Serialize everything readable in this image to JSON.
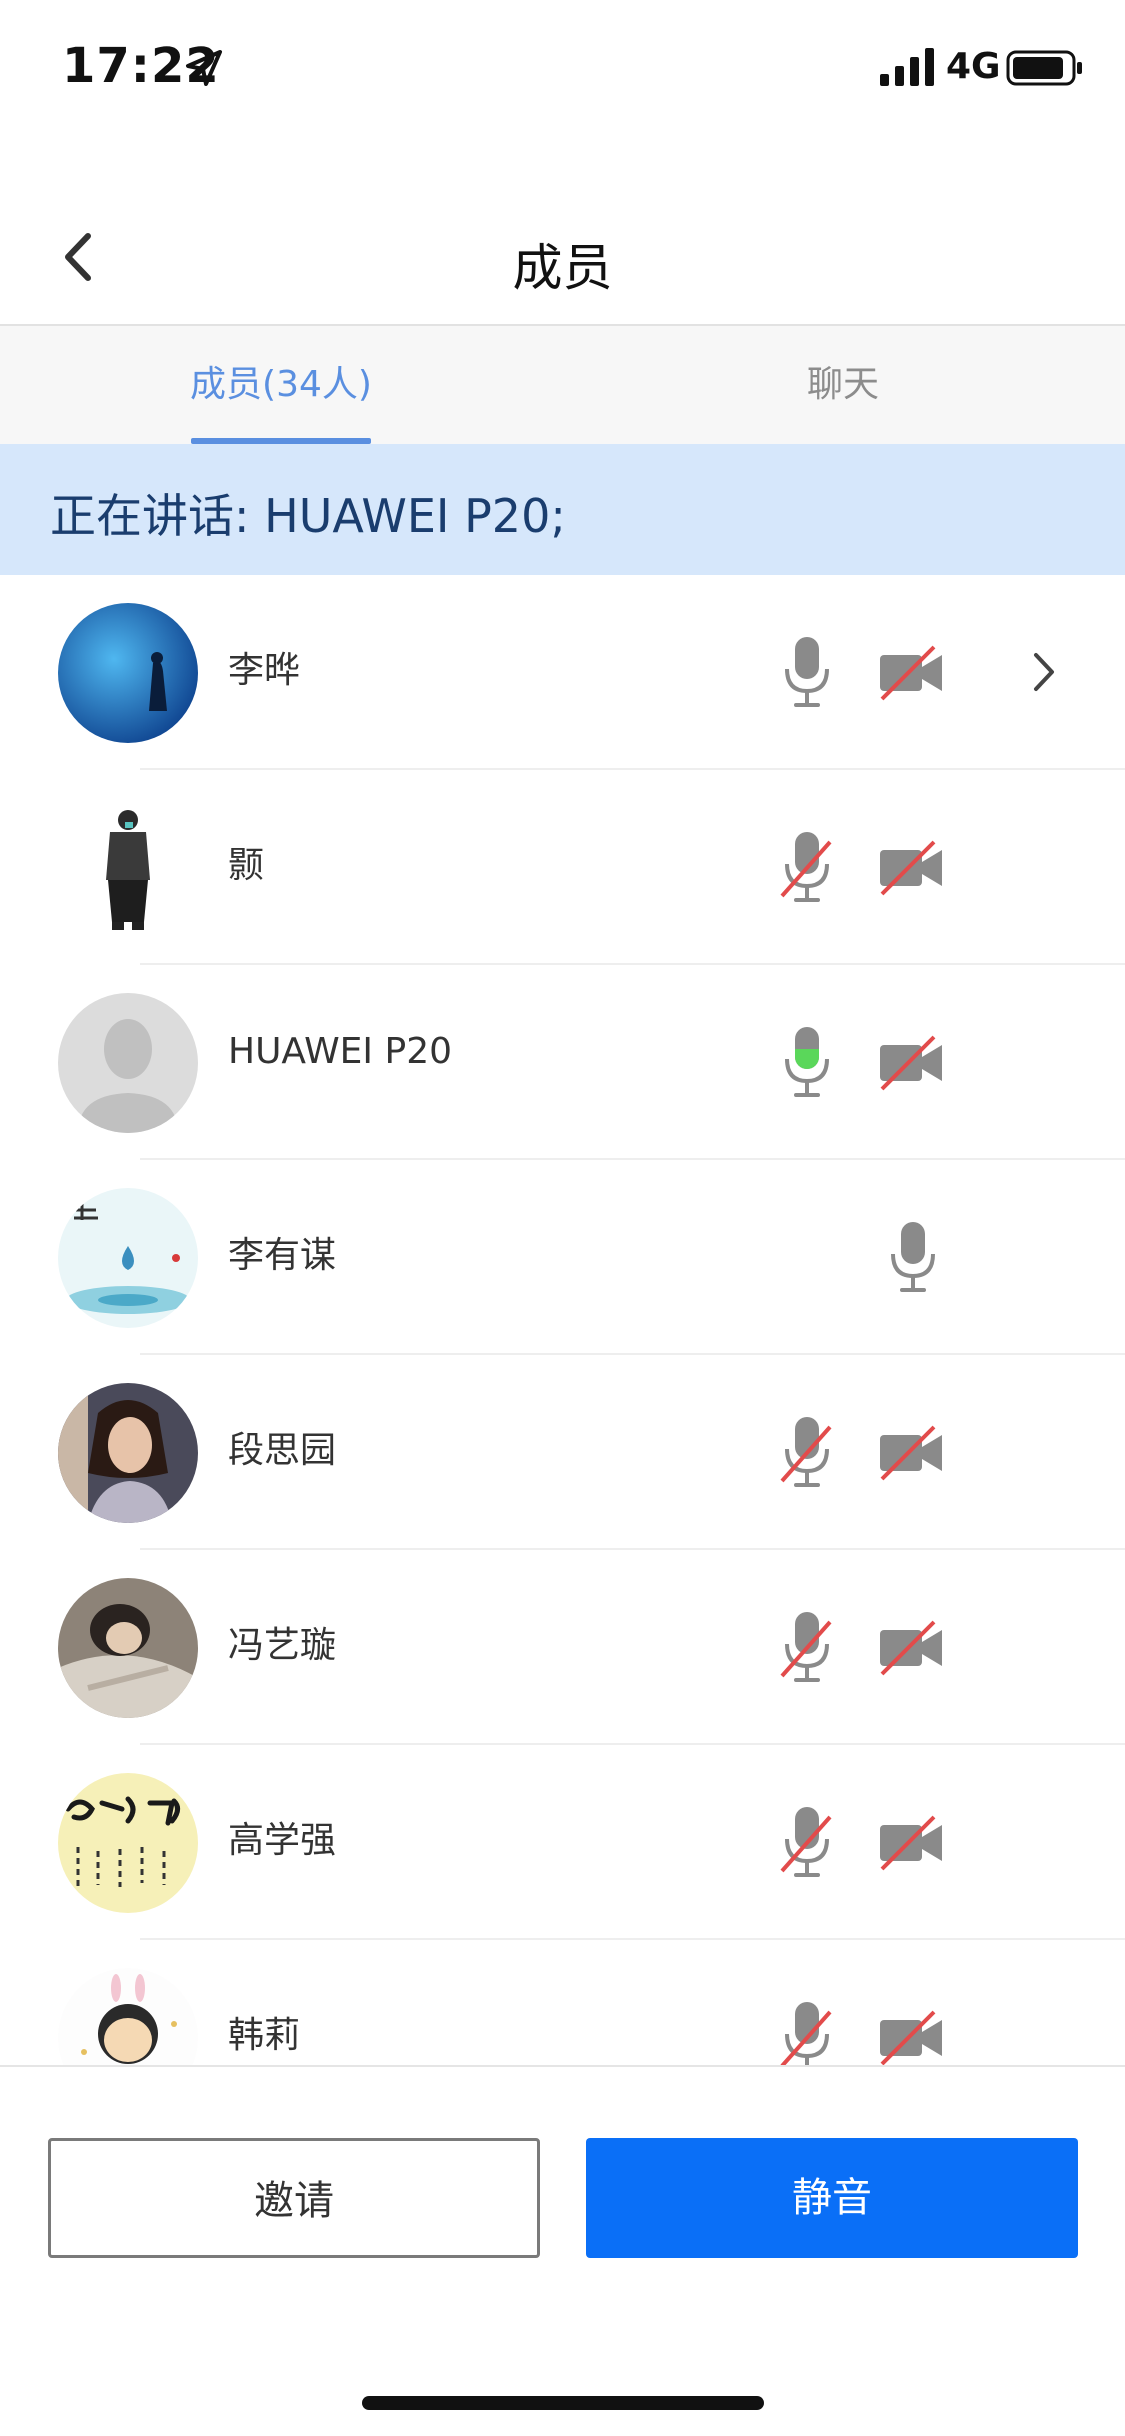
{
  "status_bar": {
    "time": "17:22",
    "network": "4G",
    "icons": [
      "location-arrow-icon",
      "cellular-signal-icon",
      "battery-icon"
    ]
  },
  "nav": {
    "title": "成员",
    "back_icon": "chevron-left-icon"
  },
  "tabs": [
    {
      "label": "成员(34人)",
      "active": true
    },
    {
      "label": "聊天",
      "active": false
    }
  ],
  "speaking_banner": "正在讲话: HUAWEI P20;",
  "members": [
    {
      "name": "李晔",
      "mic": "on",
      "camera": "off",
      "chevron": true,
      "avatar": "aquarium-photo"
    },
    {
      "name": "颢",
      "mic": "muted",
      "camera": "off",
      "chevron": false,
      "avatar": "person-figure"
    },
    {
      "name": "HUAWEI P20",
      "mic": "speaking",
      "camera": "off",
      "chevron": false,
      "avatar": "default-avatar"
    },
    {
      "name": "李有谋",
      "mic": "on",
      "camera": "none",
      "chevron": false,
      "avatar": "water-drop-art"
    },
    {
      "name": "段思园",
      "mic": "muted",
      "camera": "off",
      "chevron": false,
      "avatar": "portrait-photo"
    },
    {
      "name": "冯艺璇",
      "mic": "muted",
      "camera": "off",
      "chevron": false,
      "avatar": "anime-art"
    },
    {
      "name": "高学强",
      "mic": "muted",
      "camera": "off",
      "chevron": false,
      "avatar": "calligraphy"
    },
    {
      "name": "韩莉",
      "mic": "muted",
      "camera": "off",
      "chevron": false,
      "avatar": "cartoon-girl"
    }
  ],
  "buttons": {
    "invite": "邀请",
    "mute": "静音"
  },
  "colors": {
    "accent": "#0a6ff7",
    "tab_active": "#5a8fe0",
    "banner_bg": "#d6e7fb",
    "speaking_green": "#5ad75a",
    "muted_red": "#e24b4b"
  }
}
